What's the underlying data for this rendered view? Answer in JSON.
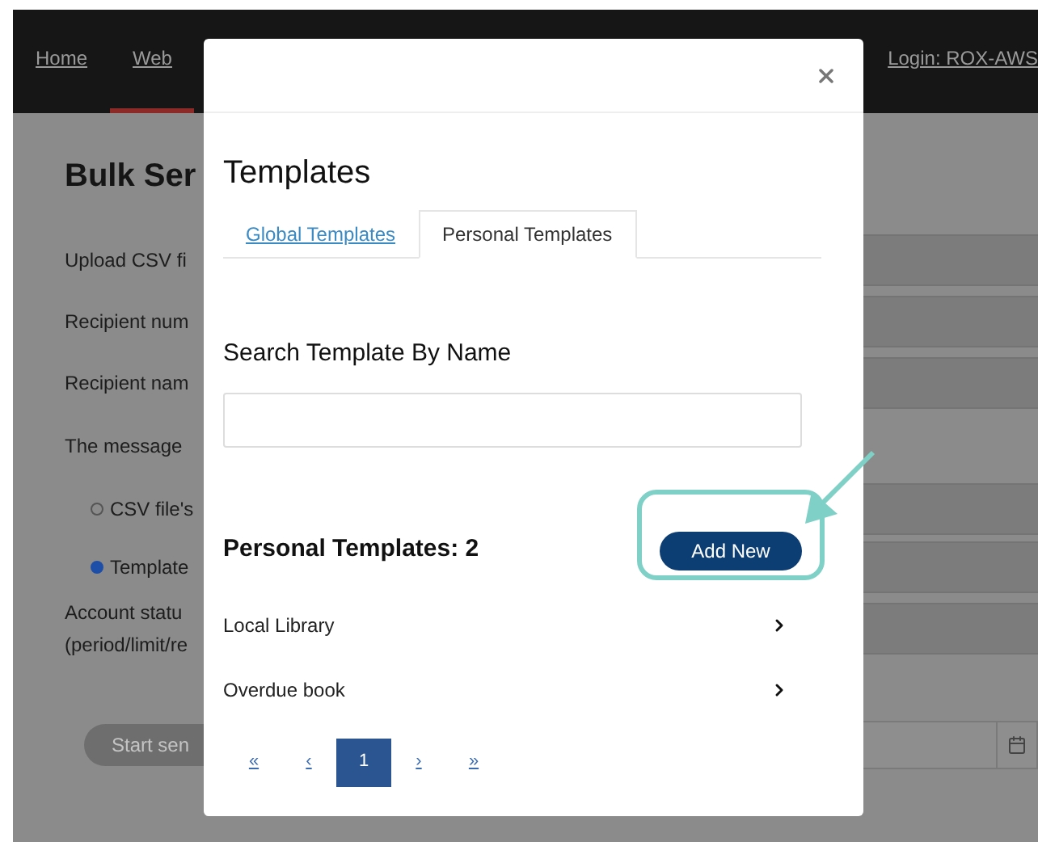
{
  "nav": {
    "links": [
      {
        "label": "Home",
        "selected": false
      },
      {
        "label": "Web",
        "selected": true
      }
    ],
    "login": "Login: ROX-AWS"
  },
  "page": {
    "title": "Bulk Ser",
    "rows": [
      {
        "kind": "field",
        "label": "Upload CSV fi"
      },
      {
        "kind": "field",
        "label": "Recipient num"
      },
      {
        "kind": "field",
        "label": "Recipient nam"
      },
      {
        "kind": "heading",
        "label": "The message"
      },
      {
        "kind": "radio",
        "label": "CSV file's",
        "selected": false
      },
      {
        "kind": "radio",
        "label": "Template",
        "selected": true
      },
      {
        "kind": "field",
        "label": "Account statu\n(period/limit/re"
      }
    ],
    "start_button": "Start sen"
  },
  "modal": {
    "title": "Templates",
    "tabs": [
      {
        "label": "Global Templates",
        "selected": false
      },
      {
        "label": "Personal Templates",
        "selected": true
      }
    ],
    "search": {
      "label": "Search Template By Name"
    },
    "count": "Personal Templates: 2",
    "add_button": "Add New",
    "items": [
      "Local Library",
      "Overdue book"
    ],
    "pagination": [
      {
        "label": "«",
        "selected": false
      },
      {
        "label": "‹",
        "selected": false
      },
      {
        "label": "1",
        "selected": true
      },
      {
        "label": "›",
        "selected": false
      },
      {
        "label": "»",
        "selected": false
      }
    ]
  }
}
